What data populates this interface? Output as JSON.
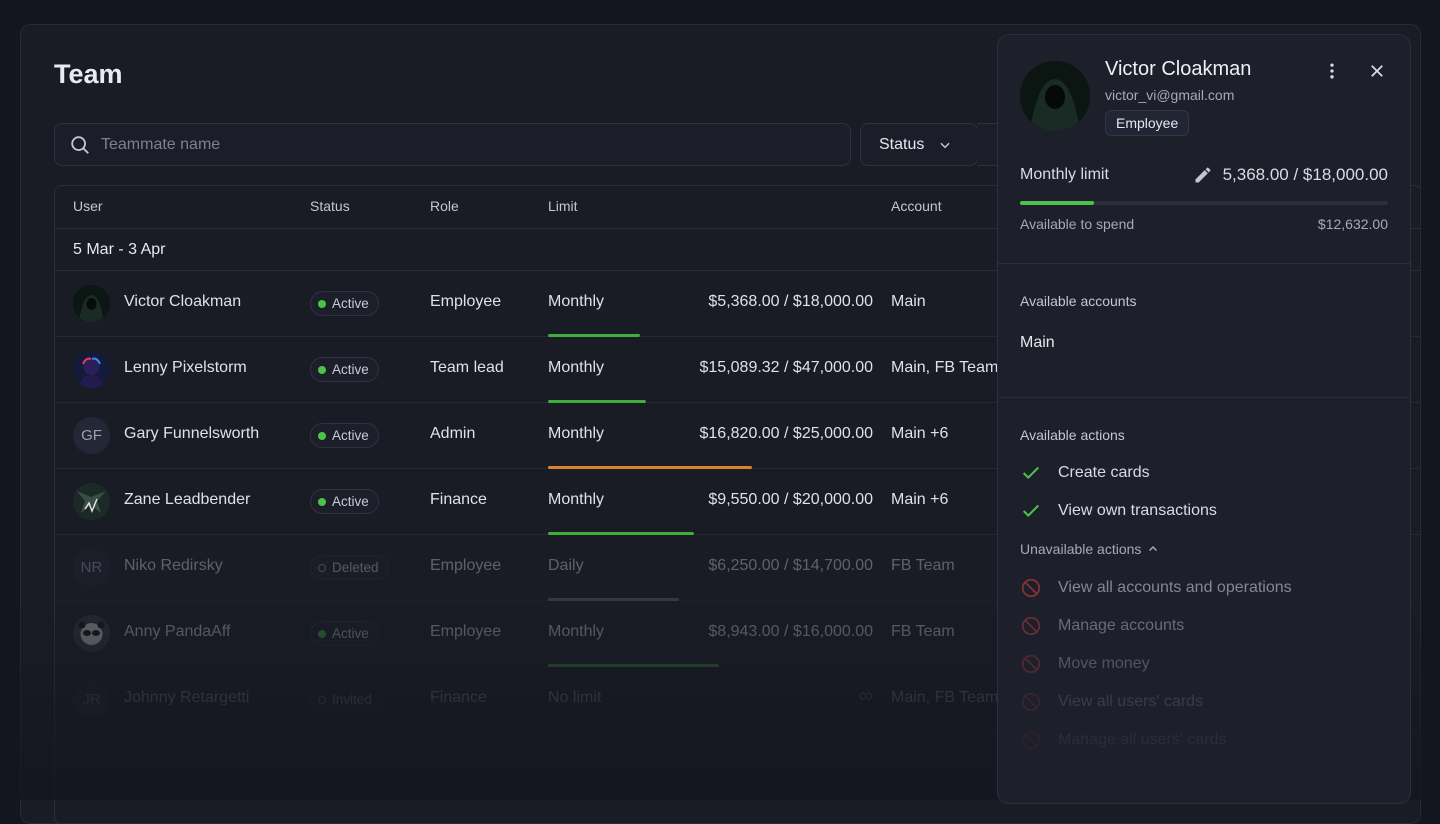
{
  "page": {
    "title": "Team"
  },
  "search": {
    "placeholder": "Teammate name"
  },
  "filters": {
    "status_label": "Status"
  },
  "table": {
    "headers": {
      "user": "User",
      "status": "Status",
      "role": "Role",
      "limit": "Limit",
      "account": "Account"
    },
    "group_label": "5 Mar - 3 Apr",
    "rows": [
      {
        "name": "Victor Cloakman",
        "status": "Active",
        "role": "Employee",
        "period": "Monthly",
        "spent": "$5,368.00",
        "limit": "/ $18,000.00",
        "account": "Main",
        "progress": 0.3,
        "bar_color": "#3fae3c"
      },
      {
        "name": "Lenny Pixelstorm",
        "status": "Active",
        "role": "Team lead",
        "period": "Monthly",
        "spent": "$15,089.32",
        "limit": "/ $47,000.00",
        "account": "Main, FB Team",
        "progress": 0.32,
        "bar_color": "#3fae3c"
      },
      {
        "name": "Gary Funnelsworth",
        "initials": "GF",
        "status": "Active",
        "role": "Admin",
        "period": "Monthly",
        "spent": "$16,820.00",
        "limit": "/ $25,000.00",
        "account": "Main +6",
        "progress": 0.67,
        "bar_color": "#d9812f"
      },
      {
        "name": "Zane Leadbender",
        "status": "Active",
        "role": "Finance",
        "period": "Monthly",
        "spent": "$9,550.00",
        "limit": "/ $20,000.00",
        "account": "Main +6",
        "progress": 0.48,
        "bar_color": "#3fae3c"
      },
      {
        "name": "Niko Redirsky",
        "initials": "NR",
        "status": "Deleted",
        "role": "Employee",
        "period": "Daily",
        "spent": "$6,250.00",
        "limit": "/ $14,700.00",
        "account": "FB Team",
        "progress": 0.43,
        "bar_color": "#6a6e7d"
      },
      {
        "name": "Anny PandaAff",
        "status": "Active",
        "role": "Employee",
        "period": "Monthly",
        "spent": "$8,943.00",
        "limit": "/ $16,000.00",
        "account": "FB Team",
        "progress": 0.56,
        "bar_color": "#3fae3c"
      },
      {
        "name": "Johnny Retargetti",
        "initials": "JR",
        "status": "Invited",
        "role": "Finance",
        "period": "No limit",
        "spent": "",
        "limit": "",
        "account": "Main, FB Team",
        "infinite": "∞"
      }
    ]
  },
  "panel": {
    "name": "Victor Cloakman",
    "email": "victor_vi@gmail.com",
    "role": "Employee",
    "limit_label": "Monthly limit",
    "limit_value": "5,368.00 / $18,000.00",
    "limit_progress": 0.2,
    "available_label": "Available to spend",
    "available_value": "$12,632.00",
    "accounts_title": "Available accounts",
    "accounts": [
      "Main"
    ],
    "actions_title": "Available actions",
    "actions": [
      "Create cards",
      "View own transactions"
    ],
    "unavailable_title": "Unavailable actions",
    "unavailable_actions": [
      "View all accounts and operations",
      "Manage accounts",
      "Move money",
      "View all users' cards",
      "Manage all users' cards"
    ]
  },
  "colors": {
    "accent_green": "#4cc24a",
    "warn_orange": "#d9812f",
    "forbid_red": "#d2453f"
  }
}
